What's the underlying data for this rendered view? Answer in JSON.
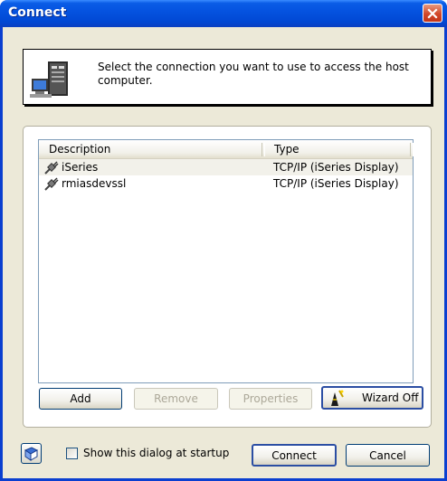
{
  "window": {
    "title": "Connect"
  },
  "header": {
    "message": "Select the connection you want to use to access the host computer."
  },
  "list": {
    "columns": [
      "Description",
      "Type"
    ],
    "rows": [
      {
        "name": "iSeries",
        "type": "TCP/IP (iSeries Display)",
        "selected": true
      },
      {
        "name": "rmiasdevssl",
        "type": "TCP/IP (iSeries Display)",
        "selected": false
      }
    ]
  },
  "buttons": {
    "add": "Add",
    "remove": "Remove",
    "properties": "Properties",
    "wizard": "Wizard Off",
    "connect": "Connect",
    "cancel": "Cancel"
  },
  "footer": {
    "startup_label": "Show this dialog at startup",
    "startup_checked": false
  },
  "icons": {
    "close": "close-icon",
    "host": "computer-host-icon",
    "connection": "connection-plug-icon",
    "wizard": "wizard-icon",
    "help": "help-book-icon"
  },
  "colors": {
    "titlebar": "#0553e0",
    "dialog": "#ece9d8",
    "close": "#d2482a"
  }
}
